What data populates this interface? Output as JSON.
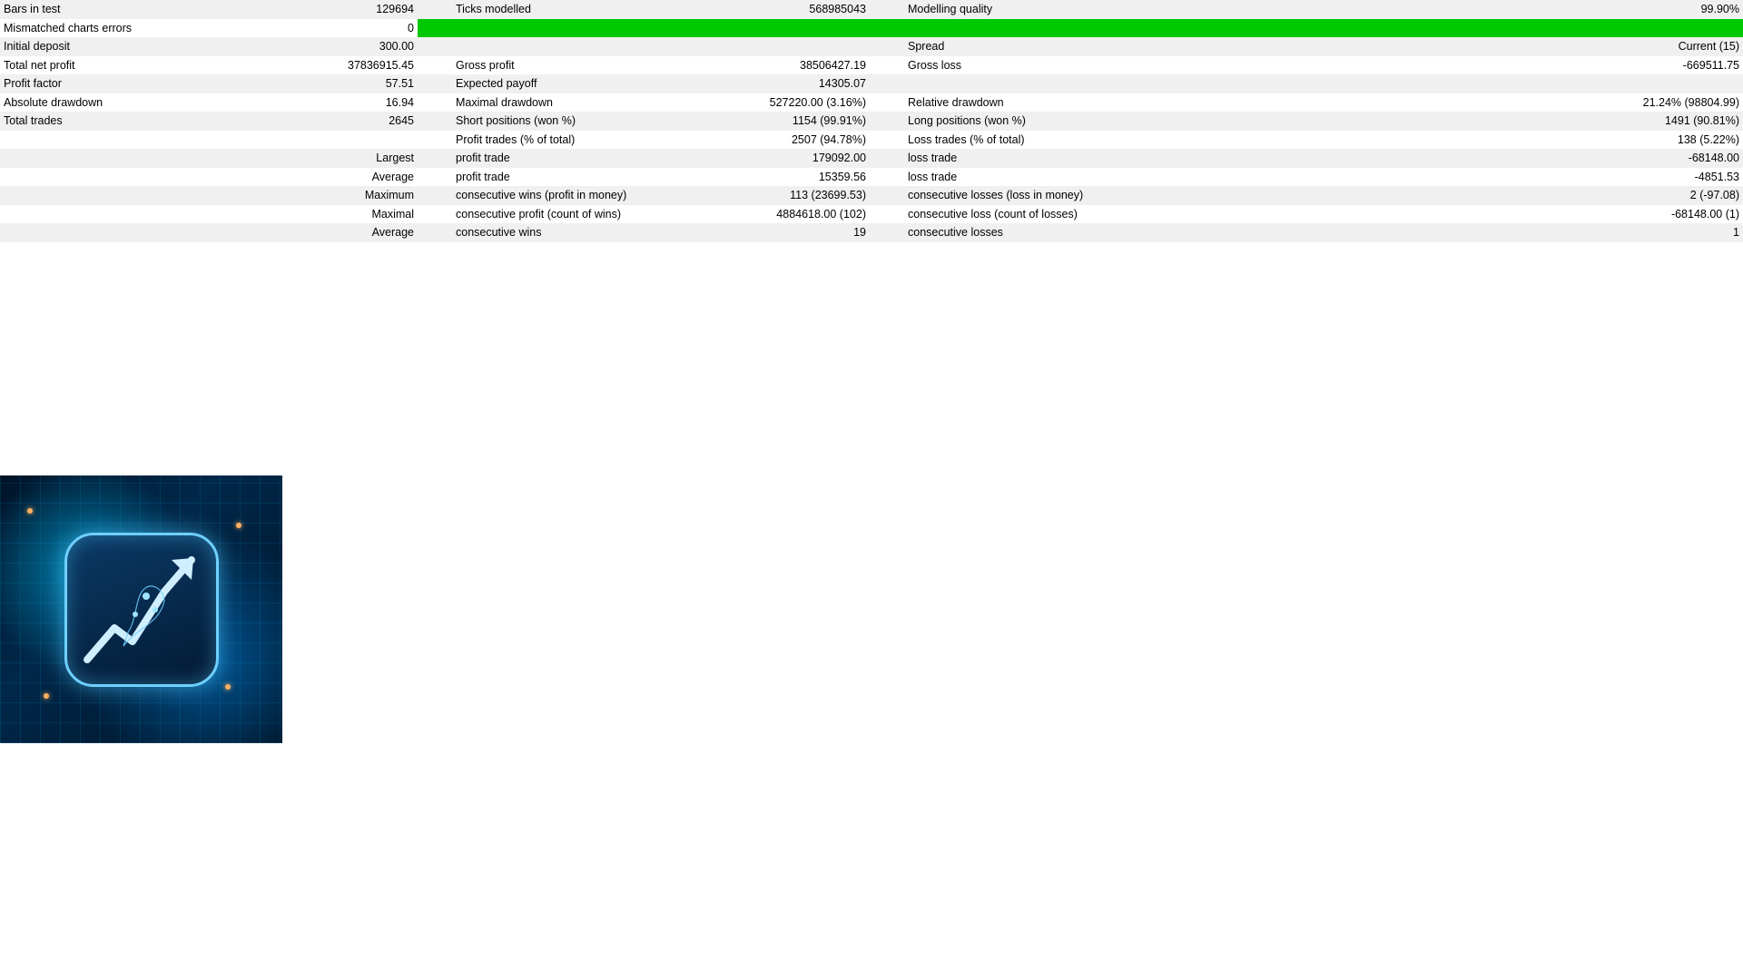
{
  "rows": [
    {
      "bg": "odd",
      "c1l": "Bars in test",
      "c1v": "129694",
      "c2l": "Ticks modelled",
      "c2v": "568985043",
      "c3l": "Modelling quality",
      "c3v": "99.90%"
    },
    {
      "bg": "even",
      "green": true,
      "c1l": "Mismatched charts errors",
      "c1v": "0",
      "c2l": "",
      "c2v": "",
      "c3l": "",
      "c3v": ""
    },
    {
      "bg": "odd",
      "c1l": "Initial deposit",
      "c1v": "300.00",
      "c2l": "",
      "c2v": "",
      "c3l": "Spread",
      "c3v": "Current (15)"
    },
    {
      "bg": "even",
      "c1l": "Total net profit",
      "c1v": "37836915.45",
      "c2l": "Gross profit",
      "c2v": "38506427.19",
      "c3l": "Gross loss",
      "c3v": "-669511.75"
    },
    {
      "bg": "odd",
      "c1l": "Profit factor",
      "c1v": "57.51",
      "c2l": "Expected payoff",
      "c2v": "14305.07",
      "c3l": "",
      "c3v": ""
    },
    {
      "bg": "even",
      "c1l": "Absolute drawdown",
      "c1v": "16.94",
      "c2l": "Maximal drawdown",
      "c2v": "527220.00 (3.16%)",
      "c3l": "Relative drawdown",
      "c3v": "21.24% (98804.99)"
    },
    {
      "bg": "odd",
      "c1l": "Total trades",
      "c1v": "2645",
      "c2l": "Short positions (won %)",
      "c2v": "1154 (99.91%)",
      "c3l": "Long positions (won %)",
      "c3v": "1491 (90.81%)"
    },
    {
      "bg": "even",
      "c1l": "",
      "c1v": "",
      "c2l": "Profit trades (% of total)",
      "c2v": "2507 (94.78%)",
      "c3l": "Loss trades (% of total)",
      "c3v": "138 (5.22%)"
    },
    {
      "bg": "odd",
      "c1l": "",
      "c1v": "Largest",
      "c2l": "profit trade",
      "c2v": "179092.00",
      "c3l": "loss trade",
      "c3v": "-68148.00"
    },
    {
      "bg": "even",
      "c1l": "",
      "c1v": "Average",
      "c2l": "profit trade",
      "c2v": "15359.56",
      "c3l": "loss trade",
      "c3v": "-4851.53"
    },
    {
      "bg": "odd",
      "c1l": "",
      "c1v": "Maximum",
      "c2l": "consecutive wins (profit in money)",
      "c2v": "113 (23699.53)",
      "c3l": "consecutive losses (loss in money)",
      "c3v": "2 (-97.08)"
    },
    {
      "bg": "even",
      "c1l": "",
      "c1v": "Maximal",
      "c2l": "consecutive profit (count of wins)",
      "c2v": "4884618.00 (102)",
      "c3l": "consecutive loss (count of losses)",
      "c3v": "-68148.00 (1)"
    },
    {
      "bg": "odd",
      "c1l": "",
      "c1v": "Average",
      "c2l": "consecutive wins",
      "c2v": "19",
      "c3l": "consecutive losses",
      "c3v": "1"
    }
  ]
}
